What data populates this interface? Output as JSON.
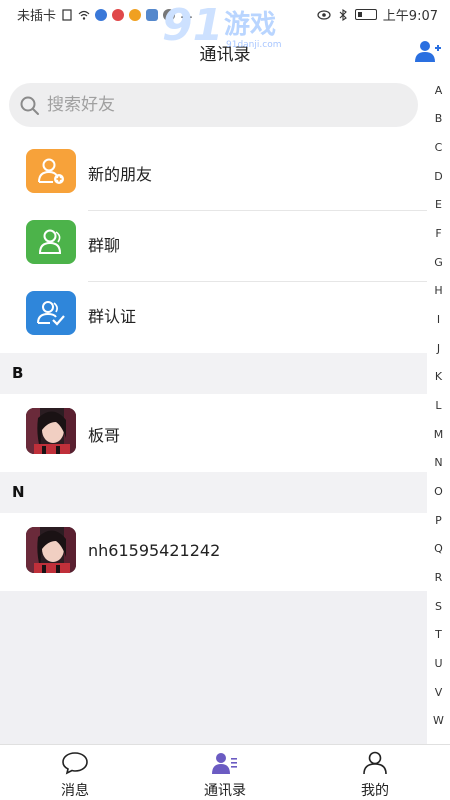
{
  "status_bar": {
    "carrier": "未插卡",
    "time": "上午9:07",
    "signal_text": "…"
  },
  "watermark": {
    "number": "91",
    "brand": "游戏",
    "url": "91danji.com"
  },
  "header": {
    "title": "通讯录",
    "add_friend_icon": "add-person-icon",
    "accent_color": "#2a6fe0"
  },
  "search": {
    "placeholder": "搜索好友",
    "value": ""
  },
  "menu_items": [
    {
      "label": "新的朋友",
      "icon": "new-friend-icon",
      "color": "#f7a23a"
    },
    {
      "label": "群聊",
      "icon": "group-chat-icon",
      "color": "#4cb34a"
    },
    {
      "label": "群认证",
      "icon": "group-verify-icon",
      "color": "#2f86da"
    }
  ],
  "sections": [
    {
      "letter": "B",
      "contacts": [
        {
          "name": "板哥"
        }
      ]
    },
    {
      "letter": "N",
      "contacts": [
        {
          "name": "nh61595421242"
        }
      ]
    }
  ],
  "index_letters": [
    "A",
    "B",
    "C",
    "D",
    "E",
    "F",
    "G",
    "H",
    "I",
    "J",
    "K",
    "L",
    "M",
    "N",
    "O",
    "P",
    "Q",
    "R",
    "S",
    "T",
    "U",
    "V",
    "W"
  ],
  "tabs": [
    {
      "label": "消息",
      "icon": "message-bubble-icon",
      "active": false
    },
    {
      "label": "通讯录",
      "icon": "contacts-icon",
      "active": true
    },
    {
      "label": "我的",
      "icon": "profile-icon",
      "active": false
    }
  ]
}
